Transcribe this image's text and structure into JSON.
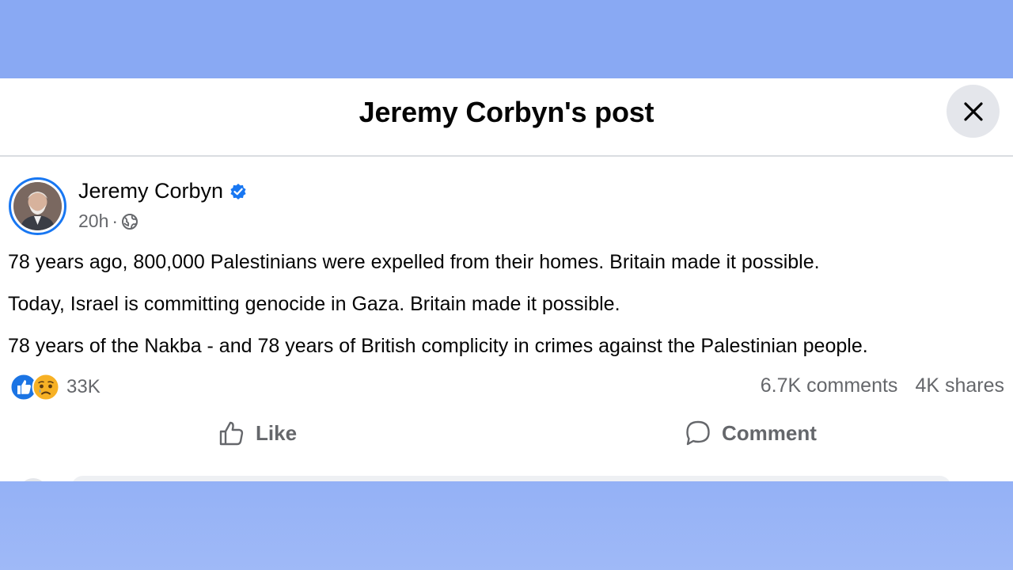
{
  "dialog": {
    "title": "Jeremy Corbyn's post",
    "close_icon": "close-icon"
  },
  "post": {
    "author": "Jeremy Corbyn",
    "verified_icon": "verified-badge-icon",
    "time": "20h",
    "separator": "·",
    "audience_icon": "globe-icon",
    "paragraphs": [
      "78 years ago, 800,000 Palestinians were expelled from their homes. Britain made it possible.",
      "Today, Israel is committing genocide in Gaza. Britain made it possible.",
      "78 years of the Nakba - and 78 years of British complicity in crimes against the Palestinian people."
    ],
    "reactions": {
      "icons": [
        "like-reaction-icon",
        "sad-reaction-icon"
      ],
      "count": "33K"
    },
    "comments": "6.7K comments",
    "shares": "4K shares"
  },
  "actions": {
    "like_label": "Like",
    "comment_label": "Comment"
  },
  "colors": {
    "background": "#8aa9f4",
    "accent": "#1877f2",
    "text": "#050505",
    "muted": "#65676b"
  }
}
